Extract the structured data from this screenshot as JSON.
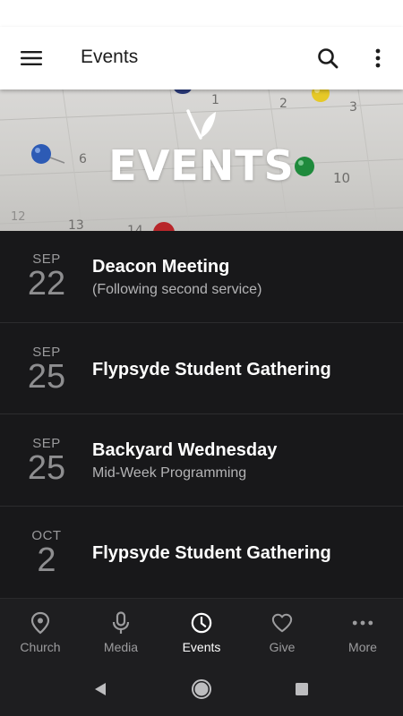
{
  "app_bar": {
    "title": "Events"
  },
  "hero": {
    "title": "EVENTS",
    "calendar_numbers": [
      "1",
      "2",
      "3",
      "6",
      "10",
      "12",
      "13",
      "14"
    ]
  },
  "events": [
    {
      "month": "SEP",
      "day": "22",
      "name": "Deacon Meeting",
      "sub": "(Following second service)"
    },
    {
      "month": "SEP",
      "day": "25",
      "name": "Flypsyde Student Gathering",
      "sub": ""
    },
    {
      "month": "SEP",
      "day": "25",
      "name": "Backyard Wednesday",
      "sub": "Mid-Week Programming"
    },
    {
      "month": "OCT",
      "day": "2",
      "name": "Flypsyde Student Gathering",
      "sub": ""
    }
  ],
  "bottom_nav": {
    "items": [
      {
        "label": "Church",
        "icon": "location-pin-icon"
      },
      {
        "label": "Media",
        "icon": "microphone-icon"
      },
      {
        "label": "Events",
        "icon": "clock-icon",
        "active": true
      },
      {
        "label": "Give",
        "icon": "heart-icon"
      },
      {
        "label": "More",
        "icon": "more-horizontal-icon"
      }
    ]
  },
  "colors": {
    "app_bar_bg": "#ffffff",
    "list_bg": "#18181a",
    "nav_bg": "#1e1e20",
    "active_nav": "#ffffff",
    "inactive_nav": "#9c9c9e"
  }
}
